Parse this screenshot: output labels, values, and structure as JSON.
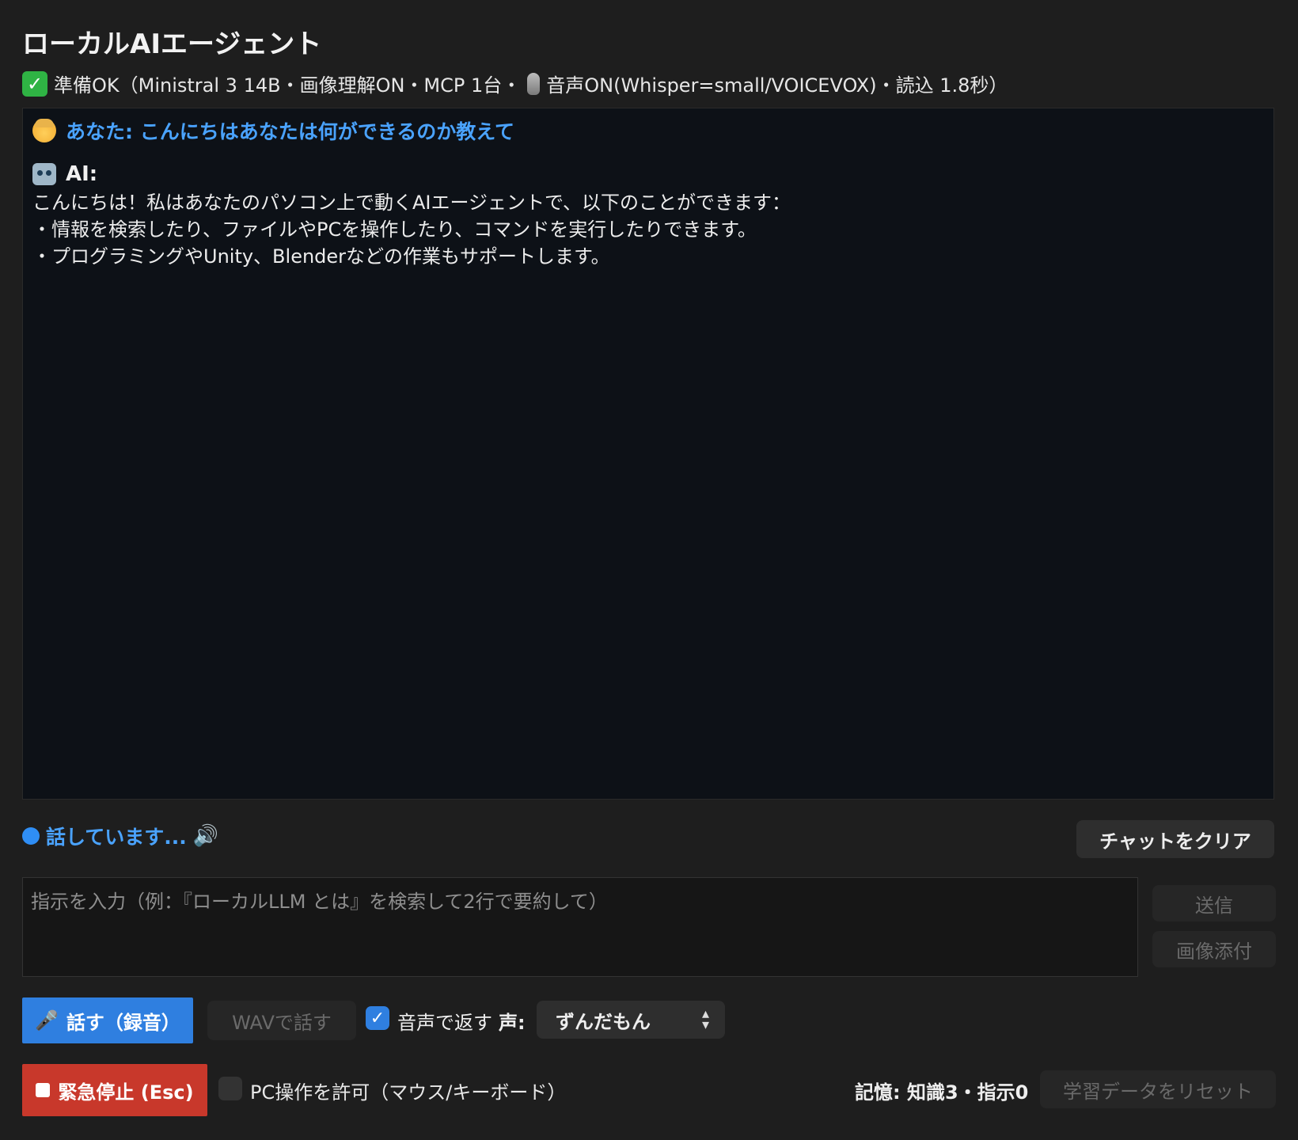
{
  "app": {
    "title": "ローカルAIエージェント"
  },
  "status": {
    "part1": "準備OK（Ministral 3 14B・画像理解ON・MCP 1台・",
    "part2": "音声ON(Whisper=small/VOICEVOX)・読込 1.8秒）"
  },
  "chat": {
    "user_message": "あなた: こんにちはあなたは何ができるのか教えて",
    "ai_label": "AI:",
    "ai_lines": [
      "こんにちは！私はあなたのパソコン上で動くAIエージェントで、以下のことができます：",
      "・情報を検索したり、ファイルやPCを操作したり、コマンドを実行したりできます。",
      "・プログラミングやUnity、Blenderなどの作業もサポートします。"
    ]
  },
  "speaking": {
    "text": "話しています..."
  },
  "buttons": {
    "clear_chat": "チャットをクリア",
    "send": "送信",
    "attach_image": "画像添付",
    "talk_record": "話す（録音）",
    "wav_talk": "WAVで話す",
    "emergency_stop": "緊急停止 (Esc)",
    "reset_learning": "学習データをリセット"
  },
  "input": {
    "placeholder": "指示を入力（例：『ローカルLLM とは』を検索して2行で要約して）",
    "value": ""
  },
  "voice": {
    "reply_with_voice_label": "音声で返す",
    "reply_with_voice_checked": true,
    "voice_label": "声:",
    "voice_selected": "ずんだもん"
  },
  "pc_control": {
    "label": "PC操作を許可（マウス/キーボード）",
    "checked": false
  },
  "memory": {
    "text": "記憶: 知識3・指示0"
  },
  "colors": {
    "accent_blue": "#2f7fe0",
    "link_blue": "#4aa3ff",
    "stop_red": "#c8382b",
    "ok_green": "#2fb344"
  },
  "icons": [
    "check-icon",
    "microphone-icon",
    "user-face-icon",
    "robot-icon",
    "speaker-icon",
    "stop-square-icon",
    "select-arrows-icon"
  ]
}
